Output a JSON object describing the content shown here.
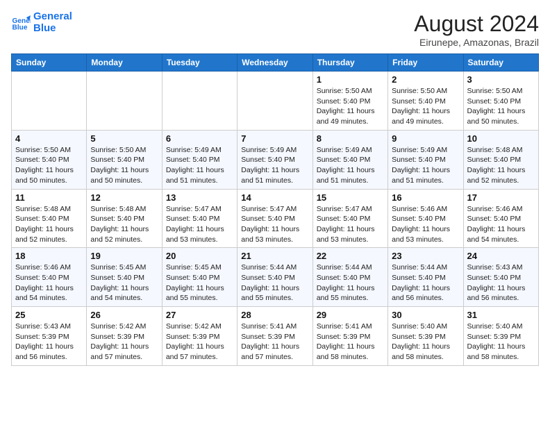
{
  "header": {
    "logo_line1": "General",
    "logo_line2": "Blue",
    "month_year": "August 2024",
    "location": "Eirunepe, Amazonas, Brazil"
  },
  "days_of_week": [
    "Sunday",
    "Monday",
    "Tuesday",
    "Wednesday",
    "Thursday",
    "Friday",
    "Saturday"
  ],
  "weeks": [
    [
      {
        "day": "",
        "info": ""
      },
      {
        "day": "",
        "info": ""
      },
      {
        "day": "",
        "info": ""
      },
      {
        "day": "",
        "info": ""
      },
      {
        "day": "1",
        "info": "Sunrise: 5:50 AM\nSunset: 5:40 PM\nDaylight: 11 hours\nand 49 minutes."
      },
      {
        "day": "2",
        "info": "Sunrise: 5:50 AM\nSunset: 5:40 PM\nDaylight: 11 hours\nand 49 minutes."
      },
      {
        "day": "3",
        "info": "Sunrise: 5:50 AM\nSunset: 5:40 PM\nDaylight: 11 hours\nand 50 minutes."
      }
    ],
    [
      {
        "day": "4",
        "info": "Sunrise: 5:50 AM\nSunset: 5:40 PM\nDaylight: 11 hours\nand 50 minutes."
      },
      {
        "day": "5",
        "info": "Sunrise: 5:50 AM\nSunset: 5:40 PM\nDaylight: 11 hours\nand 50 minutes."
      },
      {
        "day": "6",
        "info": "Sunrise: 5:49 AM\nSunset: 5:40 PM\nDaylight: 11 hours\nand 51 minutes."
      },
      {
        "day": "7",
        "info": "Sunrise: 5:49 AM\nSunset: 5:40 PM\nDaylight: 11 hours\nand 51 minutes."
      },
      {
        "day": "8",
        "info": "Sunrise: 5:49 AM\nSunset: 5:40 PM\nDaylight: 11 hours\nand 51 minutes."
      },
      {
        "day": "9",
        "info": "Sunrise: 5:49 AM\nSunset: 5:40 PM\nDaylight: 11 hours\nand 51 minutes."
      },
      {
        "day": "10",
        "info": "Sunrise: 5:48 AM\nSunset: 5:40 PM\nDaylight: 11 hours\nand 52 minutes."
      }
    ],
    [
      {
        "day": "11",
        "info": "Sunrise: 5:48 AM\nSunset: 5:40 PM\nDaylight: 11 hours\nand 52 minutes."
      },
      {
        "day": "12",
        "info": "Sunrise: 5:48 AM\nSunset: 5:40 PM\nDaylight: 11 hours\nand 52 minutes."
      },
      {
        "day": "13",
        "info": "Sunrise: 5:47 AM\nSunset: 5:40 PM\nDaylight: 11 hours\nand 53 minutes."
      },
      {
        "day": "14",
        "info": "Sunrise: 5:47 AM\nSunset: 5:40 PM\nDaylight: 11 hours\nand 53 minutes."
      },
      {
        "day": "15",
        "info": "Sunrise: 5:47 AM\nSunset: 5:40 PM\nDaylight: 11 hours\nand 53 minutes."
      },
      {
        "day": "16",
        "info": "Sunrise: 5:46 AM\nSunset: 5:40 PM\nDaylight: 11 hours\nand 53 minutes."
      },
      {
        "day": "17",
        "info": "Sunrise: 5:46 AM\nSunset: 5:40 PM\nDaylight: 11 hours\nand 54 minutes."
      }
    ],
    [
      {
        "day": "18",
        "info": "Sunrise: 5:46 AM\nSunset: 5:40 PM\nDaylight: 11 hours\nand 54 minutes."
      },
      {
        "day": "19",
        "info": "Sunrise: 5:45 AM\nSunset: 5:40 PM\nDaylight: 11 hours\nand 54 minutes."
      },
      {
        "day": "20",
        "info": "Sunrise: 5:45 AM\nSunset: 5:40 PM\nDaylight: 11 hours\nand 55 minutes."
      },
      {
        "day": "21",
        "info": "Sunrise: 5:44 AM\nSunset: 5:40 PM\nDaylight: 11 hours\nand 55 minutes."
      },
      {
        "day": "22",
        "info": "Sunrise: 5:44 AM\nSunset: 5:40 PM\nDaylight: 11 hours\nand 55 minutes."
      },
      {
        "day": "23",
        "info": "Sunrise: 5:44 AM\nSunset: 5:40 PM\nDaylight: 11 hours\nand 56 minutes."
      },
      {
        "day": "24",
        "info": "Sunrise: 5:43 AM\nSunset: 5:40 PM\nDaylight: 11 hours\nand 56 minutes."
      }
    ],
    [
      {
        "day": "25",
        "info": "Sunrise: 5:43 AM\nSunset: 5:39 PM\nDaylight: 11 hours\nand 56 minutes."
      },
      {
        "day": "26",
        "info": "Sunrise: 5:42 AM\nSunset: 5:39 PM\nDaylight: 11 hours\nand 57 minutes."
      },
      {
        "day": "27",
        "info": "Sunrise: 5:42 AM\nSunset: 5:39 PM\nDaylight: 11 hours\nand 57 minutes."
      },
      {
        "day": "28",
        "info": "Sunrise: 5:41 AM\nSunset: 5:39 PM\nDaylight: 11 hours\nand 57 minutes."
      },
      {
        "day": "29",
        "info": "Sunrise: 5:41 AM\nSunset: 5:39 PM\nDaylight: 11 hours\nand 58 minutes."
      },
      {
        "day": "30",
        "info": "Sunrise: 5:40 AM\nSunset: 5:39 PM\nDaylight: 11 hours\nand 58 minutes."
      },
      {
        "day": "31",
        "info": "Sunrise: 5:40 AM\nSunset: 5:39 PM\nDaylight: 11 hours\nand 58 minutes."
      }
    ]
  ]
}
